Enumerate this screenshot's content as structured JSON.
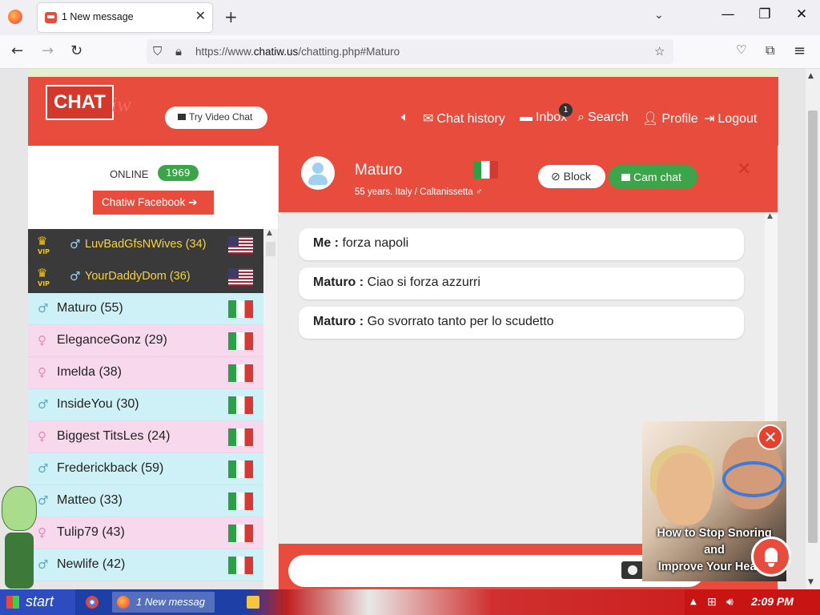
{
  "browser": {
    "tab_title": "1 New message",
    "url_prefix": "https://www.",
    "url_domain": "chatiw.us",
    "url_path": "/chatting.php#Maturo"
  },
  "site": {
    "logo_text": "CHAT",
    "logo_text2": "iw",
    "video_chat_label": "Try Video Chat",
    "nav": {
      "chat_history": "Chat history",
      "inbox": "Inbox",
      "inbox_count": "1",
      "search": "Search",
      "profile": "Profile",
      "logout": "Logout"
    }
  },
  "sidebar": {
    "online_label": "ONLINE",
    "online_count": "1969",
    "facebook_label": "Chatiw Facebook",
    "vip_label": "VIP",
    "users": [
      {
        "name": "LuvBadGfsNWives (34)",
        "type": "vip",
        "gender": "male",
        "flag": "us"
      },
      {
        "name": "YourDaddyDom (36)",
        "type": "vip",
        "gender": "male",
        "flag": "us"
      },
      {
        "name": "Maturo (55)",
        "type": "male",
        "gender": "male",
        "flag": "it"
      },
      {
        "name": "EleganceGonz (29)",
        "type": "female",
        "gender": "female",
        "flag": "it"
      },
      {
        "name": "Imelda (38)",
        "type": "female",
        "gender": "female",
        "flag": "it"
      },
      {
        "name": "InsideYou (30)",
        "type": "male",
        "gender": "male",
        "flag": "it"
      },
      {
        "name": "Biggest TitsLes (24)",
        "type": "female",
        "gender": "female",
        "flag": "it"
      },
      {
        "name": "Frederickback (59)",
        "type": "male",
        "gender": "male",
        "flag": "it"
      },
      {
        "name": "Matteo (33)",
        "type": "male",
        "gender": "male",
        "flag": "it"
      },
      {
        "name": "Tulip79 (43)",
        "type": "female",
        "gender": "female",
        "flag": "it"
      },
      {
        "name": "Newlife (42)",
        "type": "male",
        "gender": "male",
        "flag": "it"
      }
    ]
  },
  "chat": {
    "peer_name": "Maturo",
    "peer_info": "55 years. Italy / Caltanissetta",
    "block_label": "Block",
    "cam_label": "Cam chat",
    "close_symbol": "✕",
    "messages": [
      {
        "sender": "Me :",
        "text": "forza napoli"
      },
      {
        "sender": "Maturo :",
        "text": "Ciao si forza azzurri"
      },
      {
        "sender": "Maturo :",
        "text": "Go svorrato tanto per lo scudetto"
      }
    ],
    "input_value": ""
  },
  "ad": {
    "line1": "How to Stop Snoring",
    "line2": "and",
    "line3": "Improve Your Health",
    "close_symbol": "✕"
  },
  "taskbar": {
    "start_label": "start",
    "task_label": "1 New messag",
    "clock": "2:09 PM"
  },
  "colors": {
    "brand_red": "#e84c3d",
    "online_green": "#3da549",
    "male_bg": "#cdf1f6",
    "female_bg": "#f7d8ec",
    "vip_bg": "#3a3a3a"
  }
}
